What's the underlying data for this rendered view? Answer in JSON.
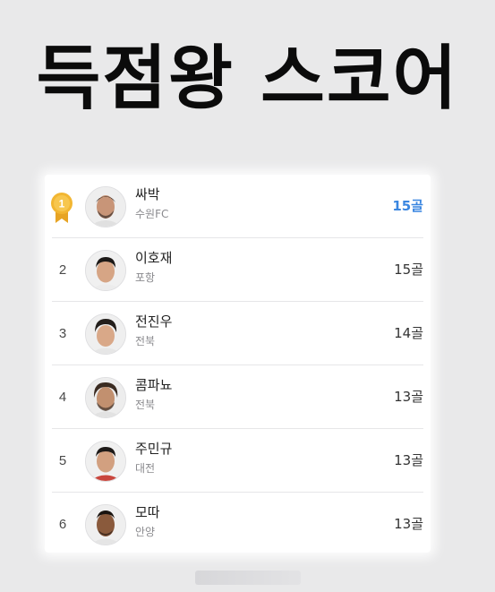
{
  "headline": "득점왕 스코어",
  "colors": {
    "leader_goals": "#3a86e0",
    "medal_gold": "#f2b632"
  },
  "rankings": [
    {
      "rank": "1",
      "medal_icon": "gold-medal-icon",
      "name": "싸박",
      "team": "수원FC",
      "goals": "15골"
    },
    {
      "rank": "2",
      "name": "이호재",
      "team": "포항",
      "goals": "15골"
    },
    {
      "rank": "3",
      "name": "전진우",
      "team": "전북",
      "goals": "14골"
    },
    {
      "rank": "4",
      "name": "콤파뇨",
      "team": "전북",
      "goals": "13골"
    },
    {
      "rank": "5",
      "name": "주민규",
      "team": "대전",
      "goals": "13골"
    },
    {
      "rank": "6",
      "name": "모따",
      "team": "안양",
      "goals": "13골"
    }
  ]
}
